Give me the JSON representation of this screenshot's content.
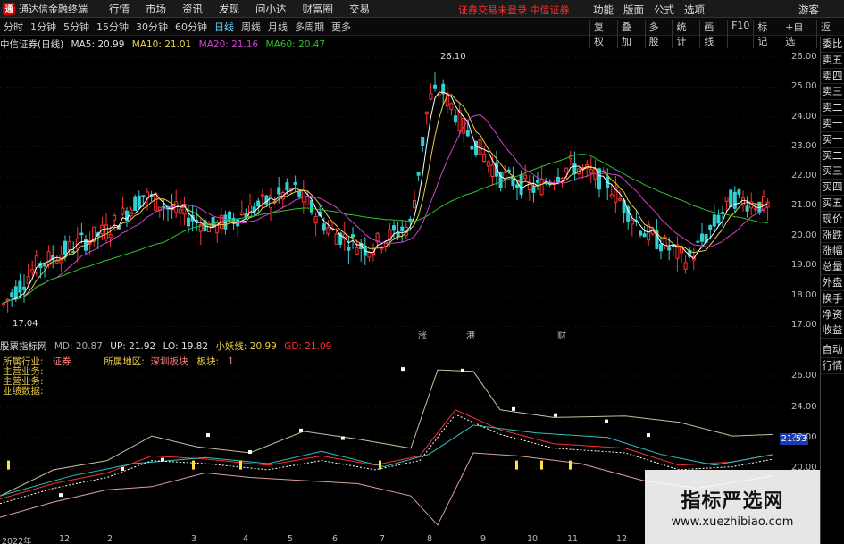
{
  "app": {
    "title": "通达信金融终端",
    "logo": "通"
  },
  "menu": [
    "行情",
    "市场",
    "资讯",
    "发现",
    "问小达",
    "财富圈",
    "交易"
  ],
  "warning": "证券交易未登录 中信证券",
  "right_menu": [
    "功能",
    "版面",
    "公式",
    "选项"
  ],
  "guest": "游客",
  "periods": [
    {
      "label": "分时"
    },
    {
      "label": "1分钟"
    },
    {
      "label": "5分钟"
    },
    {
      "label": "15分钟"
    },
    {
      "label": "30分钟"
    },
    {
      "label": "60分钟"
    },
    {
      "label": "日线",
      "selected": true
    },
    {
      "label": "周线"
    },
    {
      "label": "月线"
    },
    {
      "label": "多周期"
    },
    {
      "label": "更多"
    }
  ],
  "tools": [
    "复权",
    "叠加",
    "多股",
    "统计",
    "画线",
    "F10",
    "标记",
    "+自选",
    "返回"
  ],
  "stock": {
    "name": "中信证券(日线)",
    "ma5": "MA5: 20.99",
    "ma10": "MA10: 21.01",
    "ma20": "MA20: 21.16",
    "ma60": "MA60: 20.47",
    "high": "26.10",
    "low": "17.04"
  },
  "price_axis": [
    "26.00",
    "25.00",
    "24.00",
    "23.00",
    "22.00",
    "21.00",
    "20.00",
    "19.00",
    "18.00",
    "17.00"
  ],
  "markers": [
    {
      "text": "涨",
      "color": "#ff3030"
    },
    {
      "text": "港",
      "color": "#30e030"
    },
    {
      "text": "财",
      "color": "#5fa8ff"
    }
  ],
  "indicator": {
    "name": "股票指标网",
    "md": "MD: 20.87",
    "up": "UP: 21.92",
    "lo": "LO: 19.82",
    "xyx": "小妖线: 20.99",
    "gd": "GD: 21.09"
  },
  "info": {
    "industry_label": "所属行业:",
    "industry": "证券",
    "region_label": "所属地区:",
    "region": "深圳板块",
    "sector_label": "板块:",
    "sector": "1",
    "business": "主营业务:",
    "main": "主营业务:",
    "perf": "业绩数据:"
  },
  "ind_axis": [
    "26.00",
    "24.00",
    "22.00",
    "20.00"
  ],
  "ind_value": "21.53",
  "right_panel": [
    "委比",
    "卖五",
    "卖四",
    "卖三",
    "卖二",
    "卖一",
    "买一",
    "买二",
    "买三",
    "买四",
    "买五",
    "现价",
    "涨跌",
    "涨幅",
    "总量",
    "外盘",
    "换手",
    "净资",
    "收益",
    "自动",
    "行情"
  ],
  "dates": [
    "2022年",
    "12",
    "2",
    "3",
    "4",
    "5",
    "6",
    "7",
    "8",
    "9",
    "10",
    "11",
    "12"
  ],
  "watermark": {
    "line1": "指标严选网",
    "line2": "www.xuezhibiao.com"
  },
  "colors": {
    "up": "#ff3030",
    "down": "#30d0d0",
    "ma5": "#ffffff",
    "ma10": "#e8d048",
    "ma20": "#cc44cc",
    "ma60": "#30c030"
  }
}
